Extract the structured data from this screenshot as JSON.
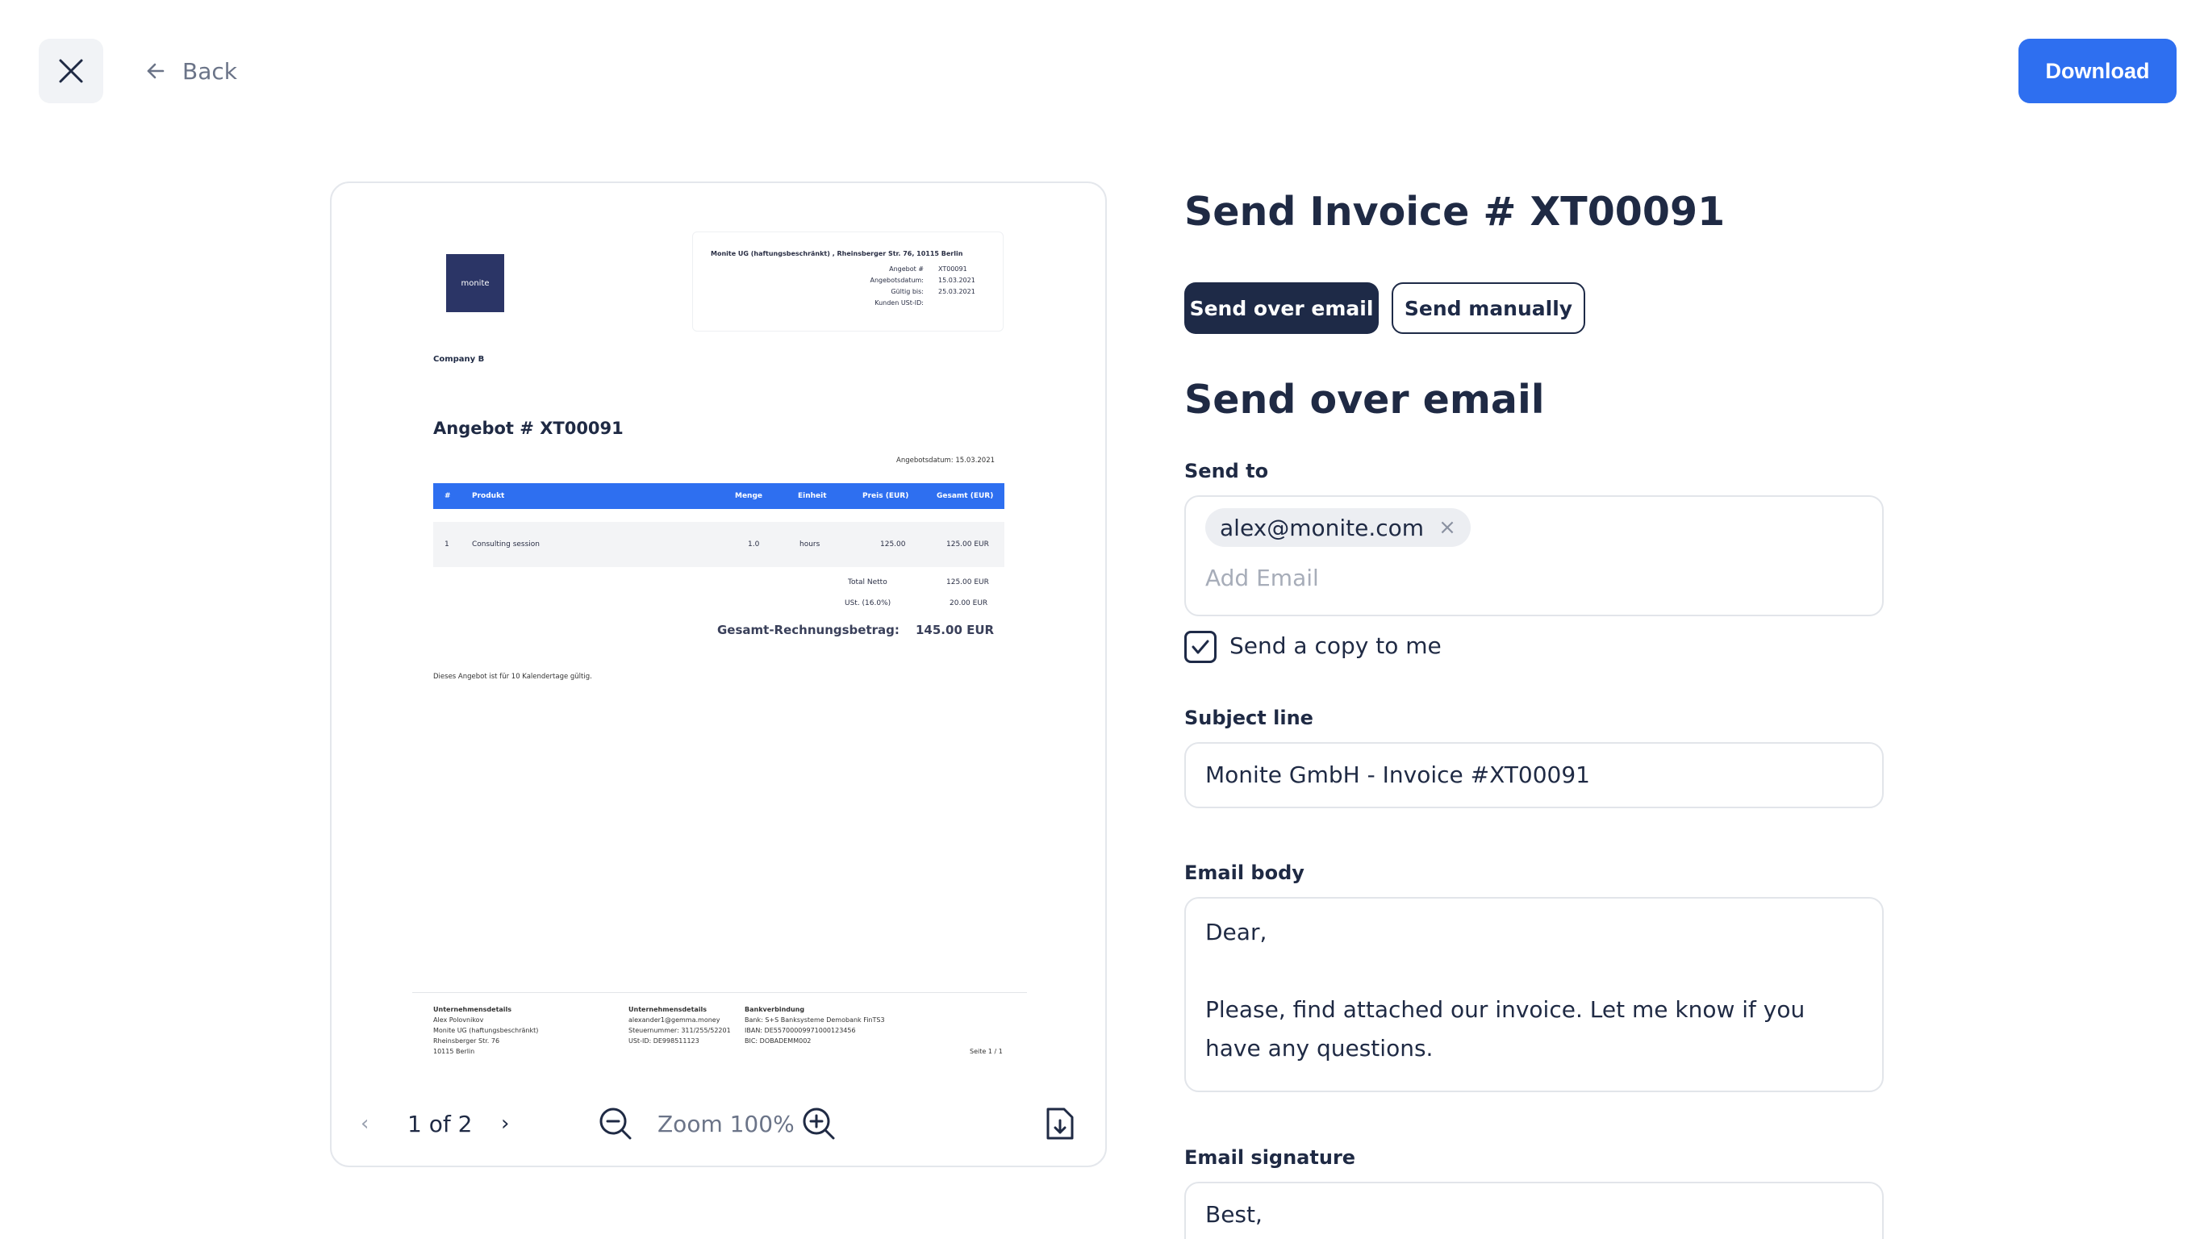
{
  "topbar": {
    "back_label": "Back",
    "download_label": "Download"
  },
  "preview": {
    "document": {
      "logo_text": "monite",
      "sender_line": "Monite UG (haftungsbeschränkt) , Rheinsberger Str. 76, 10115 Berlin",
      "meta": [
        {
          "key": "Angebot #",
          "value": "XT00091"
        },
        {
          "key": "Angebotsdatum:",
          "value": "15.03.2021"
        },
        {
          "key": "Gültig bis:",
          "value": "25.03.2021"
        },
        {
          "key": "Kunden USt-ID:",
          "value": ""
        }
      ],
      "company": "Company B",
      "title": "Angebot # XT00091",
      "date_line": "Angebotsdatum: 15.03.2021",
      "table_headers": [
        "#",
        "Produkt",
        "Menge",
        "Einheit",
        "Preis (EUR)",
        "Gesamt (EUR)"
      ],
      "rows": [
        {
          "num": "1",
          "product": "Consulting session",
          "qty": "1.0",
          "unit": "hours",
          "price": "125.00",
          "total": "125.00 EUR"
        }
      ],
      "totals": [
        {
          "label": "Total Netto",
          "value": "125.00 EUR"
        },
        {
          "label": "USt. (16.0%)",
          "value": "20.00 EUR"
        }
      ],
      "grand_total_label": "Gesamt-Rechnungsbetrag:",
      "grand_total_value": "145.00 EUR",
      "note": "Dieses Angebot ist für 10 Kalendertage gültig.",
      "footer": {
        "col1_title": "Unternehmensdetails",
        "col1_lines": [
          "Alex Polovnikov",
          "Monite UG (haftungsbeschränkt)",
          "Rheinsberger Str. 76",
          "10115 Berlin"
        ],
        "col2_title": "Unternehmensdetails",
        "col2_lines": [
          "alexander1@gemma.money",
          "Steuernummer: 311/255/52201",
          "USt-ID: DE998511123"
        ],
        "col3_title": "Bankverbindung",
        "col3_lines": [
          "Bank: S+S Banksysteme Demobank FinTS3",
          "IBAN: DE55700009971000123456",
          "BIC: DOBADEMM002"
        ],
        "page_label": "Seite 1 / 1"
      }
    },
    "controls": {
      "page_indicator": "1 of 2",
      "zoom_label": "Zoom 100%"
    }
  },
  "form": {
    "title": "Send Invoice # XT00091",
    "tabs": {
      "email": "Send over email",
      "manual": "Send manually"
    },
    "section_title": "Send over email",
    "send_to_label": "Send to",
    "recipient_chip": "alex@monite.com",
    "add_email_placeholder": "Add Email",
    "copy_label": "Send a copy to me",
    "copy_checked": true,
    "subject_label": "Subject line",
    "subject_value": "Monite GmbH - Invoice  #XT00091",
    "body_label": "Email body",
    "body_line1": "Dear,",
    "body_line2": "Please, find attached our invoice. Let me know if you have any questions.",
    "signature_label": "Email signature",
    "signature_value": "Best,"
  },
  "colors": {
    "accent": "#2e6ff0",
    "dark": "#1e2a47"
  }
}
